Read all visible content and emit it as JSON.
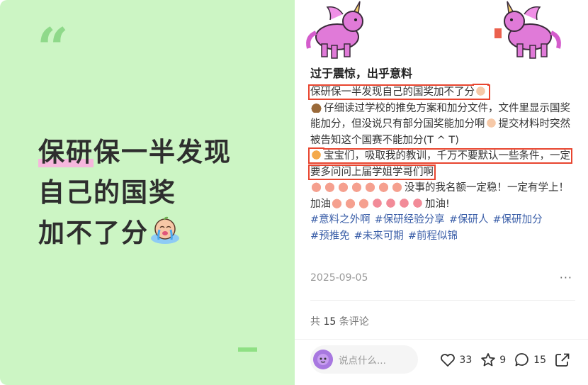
{
  "cover": {
    "quote_mark": "“",
    "line1_highlight": "保研",
    "line1_rest": "保一半发现",
    "line2": "自己的国奖",
    "line3": "加不了分"
  },
  "post": {
    "title": "过于震惊，出乎意料",
    "p1": "保研保一半发现自己的国奖加不了分",
    "p2": "仔细读过学校的推免方案和加分文件，文件里显示国奖能加分，但没说只有部分国奖能加分啊",
    "p2b": "提交材料时突然被告知这个国赛不能加分(T ^ T)",
    "p3": "宝宝们，吸取我的教训，千万不要默认一些条件，一定要多问问上届学姐学哥们啊",
    "p4a": "没事的我名额一定稳！一定有学上！加油",
    "p4b": "加油!",
    "tags": [
      "#意料之外啊",
      "#保研经验分享",
      "#保研人",
      "#保研加分",
      "#预推免",
      "#未来可期",
      "#前程似锦"
    ],
    "date": "2025-09-05",
    "more": "···"
  },
  "comments": {
    "prefix": "共 ",
    "count": "15",
    "suffix": " 条评论"
  },
  "footer": {
    "input_placeholder": "说点什么...",
    "likes": "33",
    "collects": "9",
    "comments": "15"
  },
  "colors": {
    "cover_bg": "#ccf5c4",
    "highlight": "#f6b7dd",
    "tag": "#3a5ea8",
    "box_outline": "#e8452f"
  }
}
